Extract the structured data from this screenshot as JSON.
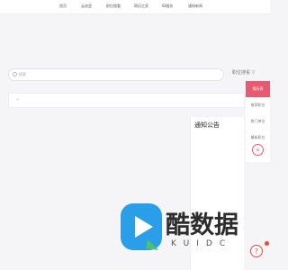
{
  "nav": {
    "items": [
      "首页",
      "云选会",
      "职位搜看",
      "简历之家",
      "ID服务",
      "通知新闻"
    ]
  },
  "search": {
    "placeholder": "搜索",
    "dropdown_label": "职位搜看 ▽"
  },
  "sidebar": {
    "items": [
      "简历表",
      "推荐职位",
      "热门单位",
      "最新职位"
    ],
    "active_index": 0,
    "extra_icon": "⌂"
  },
  "notice": {
    "title": "通知公告"
  },
  "logo": {
    "text": "酷数据",
    "sub": "KUIDC"
  },
  "help": {
    "icon": "?"
  },
  "colors": {
    "accent": "#e85a6f",
    "logo_blue": "#2a9ee8"
  }
}
